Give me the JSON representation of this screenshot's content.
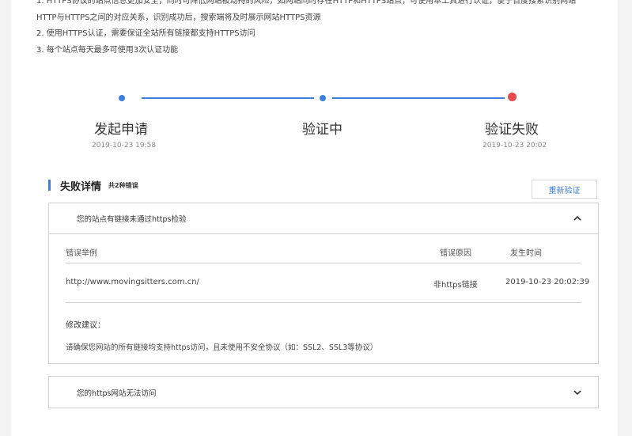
{
  "notes": [
    "1. HTTPS协议的站点信息更加安全，同时可降低网站被劫持的风险，如网站同时存在HTTP和HTTPS站点，可使用本工具进行认证，便于百度搜索识别网站",
    "HTTP与HTTPS之间的对应关系，识别成功后，搜索端将及时展示网站HTTPS资源",
    "2. 使用HTTPS认证，需要保证全站所有链接都支持HTTPS访问",
    "3. 每个站点每天最多可使用3次认证功能"
  ],
  "steps": [
    {
      "label": "发起申请",
      "time": "2019-10-23 19:58"
    },
    {
      "label": "验证中",
      "time": ""
    },
    {
      "label": "验证失败",
      "time": "2019-10-23 20:02"
    }
  ],
  "failure": {
    "title": "失败详情",
    "count": "共2种错误",
    "retry_label": "重新验证"
  },
  "errors": [
    {
      "title": "您的站点有链接未通过https检验",
      "expanded": true,
      "columns": [
        "错误举例",
        "错误原因",
        "发生时间"
      ],
      "rows": [
        {
          "example": "http://www.movingsitters.com.cn/",
          "reason": "非https链接",
          "time": "2019-10-23 20:02:39"
        }
      ],
      "fix_title": "修改建议：",
      "fix_text": "请确保您网站的所有链接均支持https访问，且未使用不安全协议（如：SSL2、SSL3等协议）"
    },
    {
      "title": "您的https网站无法访问",
      "expanded": false
    }
  ],
  "colors": {
    "accent": "#3d7ddc",
    "fail": "#e74c4c"
  }
}
